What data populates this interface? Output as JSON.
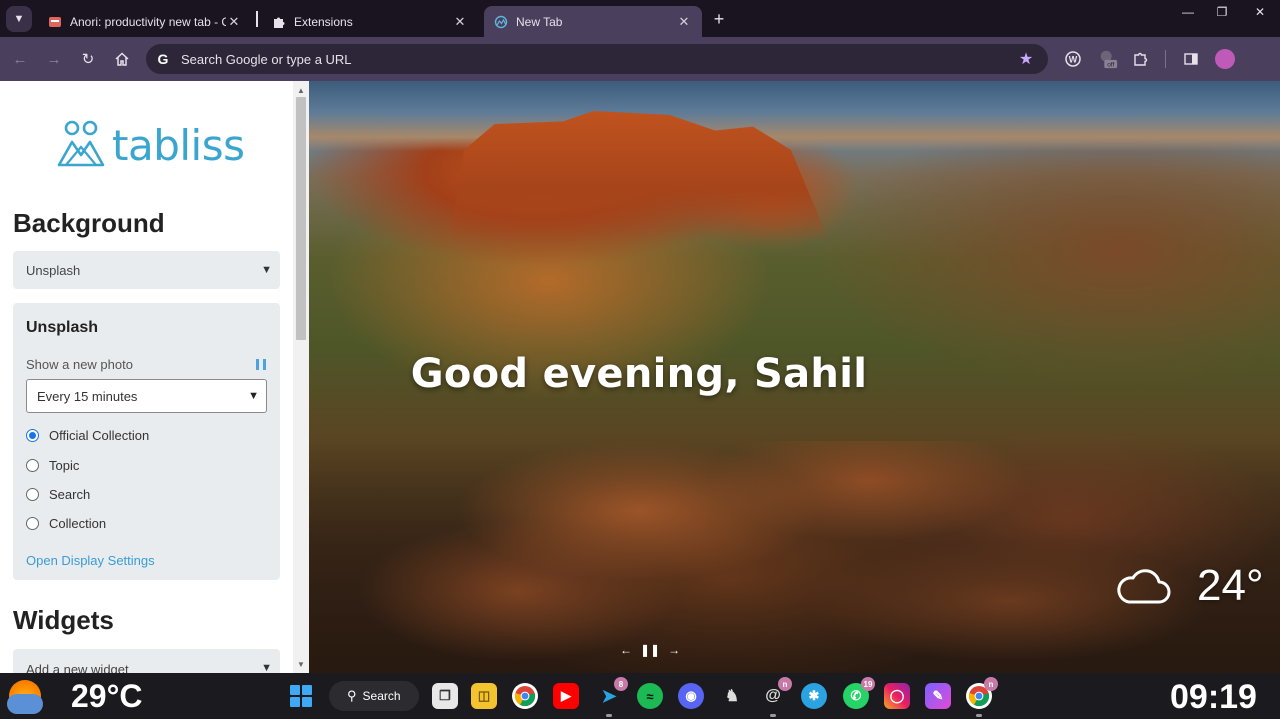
{
  "browser": {
    "tabs": [
      {
        "title": "Anori: productivity new tab - C",
        "favicon": "anori-icon",
        "active": false
      },
      {
        "title": "Extensions",
        "favicon": "puzzle-icon",
        "active": false
      },
      {
        "title": "New Tab",
        "favicon": "tabliss-icon",
        "active": true
      }
    ],
    "omnibox_placeholder": "Search Google or type a URL",
    "extension_badge": "off",
    "accent_color": "#4a3f5c"
  },
  "sidebar": {
    "logo_text": "tabliss",
    "background_heading": "Background",
    "background_source": "Unsplash",
    "panel": {
      "title": "Unsplash",
      "show_label": "Show a new photo",
      "frequency": "Every 15 minutes",
      "options": [
        {
          "label": "Official Collection",
          "checked": true
        },
        {
          "label": "Topic",
          "checked": false
        },
        {
          "label": "Search",
          "checked": false
        },
        {
          "label": "Collection",
          "checked": false
        }
      ],
      "display_link": "Open Display Settings"
    },
    "widgets_heading": "Widgets",
    "add_widget_placeholder": "Add a new widget"
  },
  "main": {
    "greeting": "Good evening, Sahil",
    "weather_temp": "24°",
    "weather_icon": "cloud-icon"
  },
  "taskbar": {
    "weather_temp": "29°C",
    "search_label": "Search",
    "badges": {
      "telegram": "8",
      "whatsapp": "19"
    },
    "clock": "09:19"
  }
}
